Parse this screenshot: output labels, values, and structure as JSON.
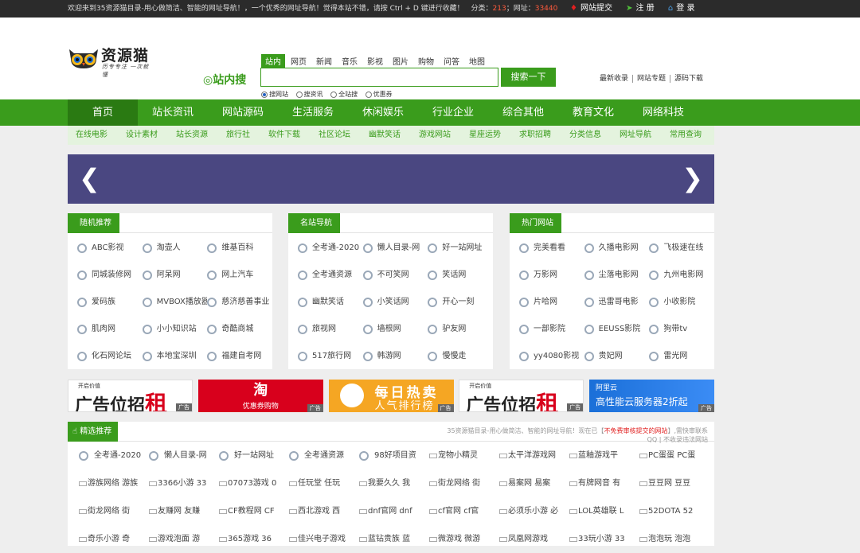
{
  "topbar": {
    "welcome": "欢迎来到35资源猫目录-用心做简洁、智能的网址导航！，一个优秀的网址导航！觉得本站不错，请按 Ctrl + D 键进行收藏！",
    "category_label": "分类：",
    "category_count": "213",
    "site_label": "；网址：",
    "site_count": "33440",
    "submit": "网站提交",
    "register": "注 册",
    "login": "登 录"
  },
  "logo": {
    "title": "资源猫",
    "slogan": "历专专注 一次就懂"
  },
  "search": {
    "brand": "站内搜",
    "tabs": [
      "站内",
      "网页",
      "新闻",
      "音乐",
      "影视",
      "图片",
      "购物",
      "问答",
      "地图"
    ],
    "button": "搜索一下",
    "radios": [
      "搜网站",
      "搜资讯",
      "全站搜",
      "优惠券"
    ]
  },
  "header_links": [
    "最新收录",
    "网站专题",
    "源码下载"
  ],
  "nav": [
    "首页",
    "站长资讯",
    "网站源码",
    "生活服务",
    "休闲娱乐",
    "行业企业",
    "综合其他",
    "教育文化",
    "网络科技"
  ],
  "subnav": [
    "在线电影",
    "设计素材",
    "站长资源",
    "旅行社",
    "软件下载",
    "社区论坛",
    "幽默笑话",
    "游戏网站",
    "星座运势",
    "求职招聘",
    "分类信息",
    "网址导航",
    "常用查询"
  ],
  "boxes": [
    {
      "title": "随机推荐",
      "items": [
        "ABC影视",
        "淘壶人",
        "维基百科",
        "同城装修网",
        "阿呆网",
        "网上汽车",
        "爱码族",
        "MVBOX播放器",
        "慈济慈善事业",
        "肌肉网",
        "小小知识站",
        "奇酷商城",
        "化石网论坛",
        "本地宝深圳",
        "福建自考网"
      ]
    },
    {
      "title": "名站导航",
      "items": [
        "全考通-2020",
        "懒人目录-网",
        "好一站网址",
        "全考通资源",
        "不可笑网",
        "笑话网",
        "幽默笑话",
        "小笑话网",
        "开心一刻",
        "旅视网",
        "墙根网",
        "驴友网",
        "517旅行网",
        "韩游网",
        "慢慢走"
      ]
    },
    {
      "title": "热门网站",
      "items": [
        "完美看看",
        "久播电影网",
        "飞极速在线",
        "万影网",
        "尘落电影网",
        "九州电影网",
        "片哈网",
        "迅雷哥电影",
        "小收影院",
        "一部影院",
        "EEUSS影院",
        "狗带tv",
        "yy4080影视",
        "贵妃网",
        "雷光网"
      ]
    }
  ],
  "ads": {
    "ad1_small": "开启价值",
    "ad1_big": "广告位招",
    "ad1_red": "租",
    "tag": "广告",
    "tb_a": "淘",
    "tb_b": "优惠券购物",
    "hot_a": "每日热卖",
    "hot_b": "人气排行榜",
    "ali_a": "阿里云",
    "ali_b": "高性能云服务器2折起"
  },
  "featured": {
    "title": "精选推荐",
    "note_1": "35资源猫目录-用心做简洁、智能的网址导航！现在已【",
    "note_red": "不免费审核提交的网站",
    "note_2": "】,需快审联系",
    "note_3": "QQ | 不收录违法网站",
    "items": [
      "全考通-2020",
      "懒人目录-网",
      "好一站网址",
      "全考通资源",
      "98好项目资",
      "宠物小精灵",
      "太平洋游戏网",
      "蓝釉游戏平",
      "PC蛋蛋 PC蛋",
      "游族网络 游族",
      "3366小游 33",
      "07073游戏 0",
      "任玩堂 任玩",
      "我要久久 我",
      "街龙网络 街",
      "易案网 易案",
      "有牌网音 有",
      "豆豆网 豆豆",
      "街龙网络 街",
      "友赚网 友赚",
      "CF教程网 CF",
      "西北游戏 西",
      "dnf官网 dnf",
      "cf官网 cf官",
      "必须乐小游 必",
      "LOL英雄联 L",
      "52DOTA 52",
      "奇乐小游 奇",
      "游戏泡面 游",
      "365游戏 36",
      "佳兴电子游戏",
      "蓝钻贵族 蓝",
      "微游戏 微游",
      "凤凰网游戏",
      "33玩小游 33",
      "泡泡玩 泡泡"
    ]
  }
}
